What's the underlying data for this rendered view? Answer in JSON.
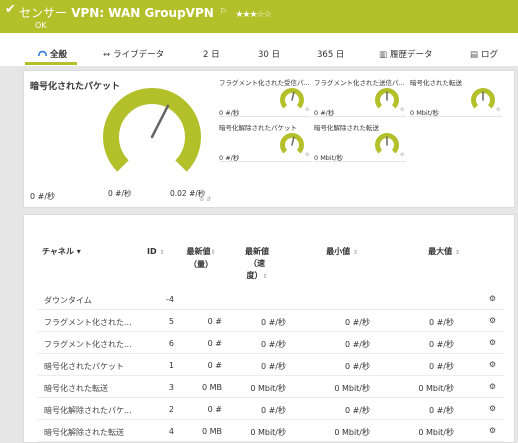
{
  "header": {
    "sensor_prefix": "センサー",
    "sensor_name": "VPN: WAN GroupVPN",
    "flag": "⚐",
    "stars": "★★★☆☆",
    "status": "OK"
  },
  "tabs": [
    {
      "label": "全般"
    },
    {
      "label": "ライブデータ"
    },
    {
      "label": "2 日"
    },
    {
      "label": "30 日"
    },
    {
      "label": "365 日"
    },
    {
      "label": "履歴データ"
    },
    {
      "label": "ログ"
    }
  ],
  "main_gauge": {
    "title": "暗号化されたパケット",
    "min_label": "0 #/秒",
    "value_label": "0 #/秒",
    "max_label": "0.02 #/秒",
    "value_fraction": 0.6
  },
  "mini_gauges": [
    {
      "title": "フラグメント化された受信パ...",
      "value": "0 #/秒",
      "fraction": 0.55
    },
    {
      "title": "フラグメント化された送信パ...",
      "value": "0 #/秒",
      "fraction": 0.5
    },
    {
      "title": "暗号化された転送",
      "value": "0 Mbit/秒",
      "fraction": 0.5
    },
    {
      "title": "暗号化解除されたパケット",
      "value": "0 #/秒",
      "fraction": 0.55
    },
    {
      "title": "暗号化解除された転送",
      "value": "0 Mbit/秒",
      "fraction": 0.5
    }
  ],
  "table": {
    "headers": {
      "channel": "チャネル ▾",
      "id": "ID",
      "last_vol_1": "最新値",
      "last_vol_2": "（量）",
      "last_spd_1": "最新値",
      "last_spd_2": "（速",
      "last_spd_3": "度）",
      "min": "最小値",
      "max": "最大値",
      "sort_icon": "⇕"
    },
    "rows": [
      {
        "name": "ダウンタイム",
        "id": "-4",
        "vol": "",
        "spd": "",
        "min": "",
        "max": ""
      },
      {
        "name": "フラグメント化された...",
        "id": "5",
        "vol": "0 #",
        "spd": "0 #/秒",
        "min": "0 #/秒",
        "max": "0 #/秒"
      },
      {
        "name": "フラグメント化された...",
        "id": "6",
        "vol": "0 #",
        "spd": "0 #/秒",
        "min": "0 #/秒",
        "max": "0 #/秒"
      },
      {
        "name": "暗号化されたパケット",
        "id": "1",
        "vol": "0 #",
        "spd": "0 #/秒",
        "min": "0 #/秒",
        "max": "0 #/秒"
      },
      {
        "name": "暗号化された転送",
        "id": "3",
        "vol": "0 MB",
        "spd": "0 Mbit/秒",
        "min": "0 Mbit/秒",
        "max": "0 Mbit/秒"
      },
      {
        "name": "暗号化解除されたパケ...",
        "id": "2",
        "vol": "0 #",
        "spd": "0 #/秒",
        "min": "0 #/秒",
        "max": "0 #/秒"
      },
      {
        "name": "暗号化解除された転送",
        "id": "4",
        "vol": "0 MB",
        "spd": "0 Mbit/秒",
        "min": "0 Mbit/秒",
        "max": "0 Mbit/秒"
      }
    ]
  },
  "colors": {
    "accent": "#b4c02a",
    "gauge_green": "#b4c02a",
    "needle": "#666666"
  }
}
